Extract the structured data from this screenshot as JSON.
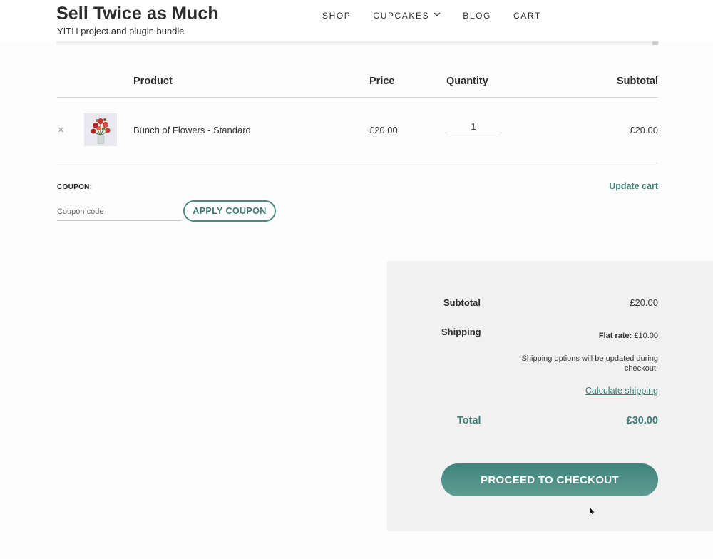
{
  "site": {
    "title": "Sell Twice as Much",
    "tagline": "YITH project and plugin bundle"
  },
  "nav": {
    "items": [
      "SHOP",
      "CUPCAKES",
      "BLOG",
      "CART"
    ]
  },
  "icons": {
    "dropdown": "chevron-down-icon",
    "remove": "close-icon",
    "cursor": "mouse-pointer-icon"
  },
  "cart": {
    "headers": {
      "product": "Product",
      "price": "Price",
      "quantity": "Quantity",
      "subtotal": "Subtotal"
    },
    "rows": [
      {
        "remove": "×",
        "thumbnail": "bunch-of-flowers-image",
        "name": "Bunch of Flowers - Standard",
        "price": "£20.00",
        "quantity": "1",
        "subtotal": "£20.00"
      }
    ]
  },
  "coupon": {
    "label": "COUPON:",
    "placeholder": "Coupon code",
    "apply_label": "APPLY COUPON",
    "update_label": "Update cart"
  },
  "totals": {
    "subtotal_label": "Subtotal",
    "subtotal_value": "£20.00",
    "shipping_label": "Shipping",
    "flat_rate_label": "Flat rate:",
    "flat_rate_value": "£10.00",
    "shipping_note": "Shipping options will be updated during checkout.",
    "calculate_shipping": "Calculate shipping",
    "total_label": "Total",
    "total_value": "£30.00",
    "checkout_label": "PROCEED TO CHECKOUT"
  },
  "colors": {
    "accent": "#3e7a72",
    "totals_bg": "#f2f1f1"
  }
}
